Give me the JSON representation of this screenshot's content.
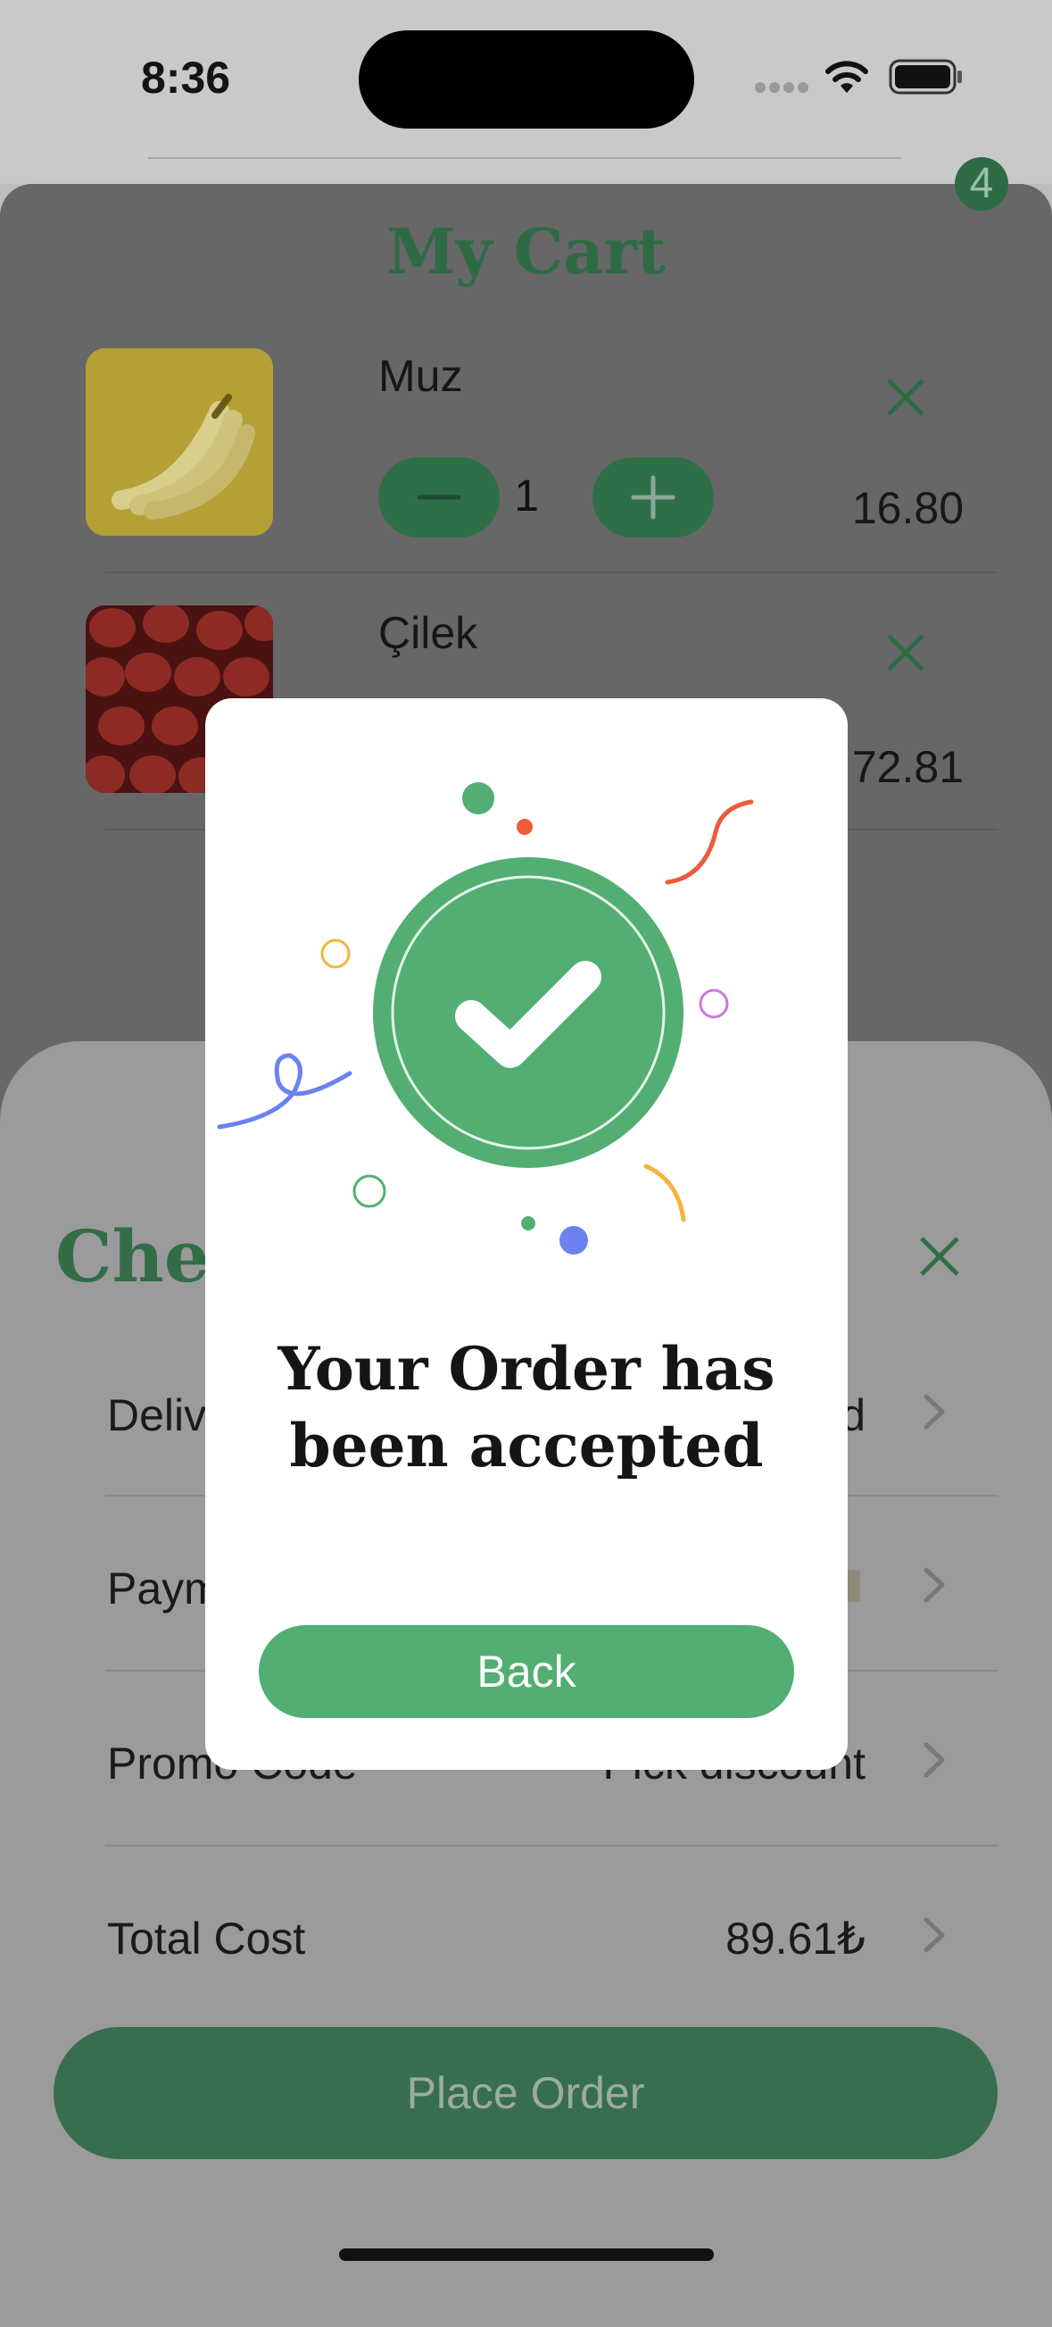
{
  "status_bar": {
    "time": "8:36"
  },
  "cart": {
    "title": "My Cart",
    "badge": "4",
    "items": [
      {
        "name": "Muz",
        "quantity": "1",
        "price": "16.80"
      },
      {
        "name": "Çilek",
        "price": "72.81"
      }
    ]
  },
  "checkout": {
    "title": "Chec",
    "rows": [
      {
        "label": "Deliv",
        "value": "d"
      },
      {
        "label": "Paym",
        "value": ""
      },
      {
        "label": "Promo Code",
        "value": "Pick discount"
      },
      {
        "label": "Total Cost",
        "value": "89.61₺"
      }
    ],
    "place_order_label": "Place Order"
  },
  "modal": {
    "title_line1": "Your Order has",
    "title_line2": "been accepted",
    "back_label": "Back"
  },
  "colors": {
    "accent": "#52ae73",
    "dark_green": "#2f6f48",
    "confetti_blue": "#6b82f0",
    "confetti_red": "#ef5a3c"
  }
}
